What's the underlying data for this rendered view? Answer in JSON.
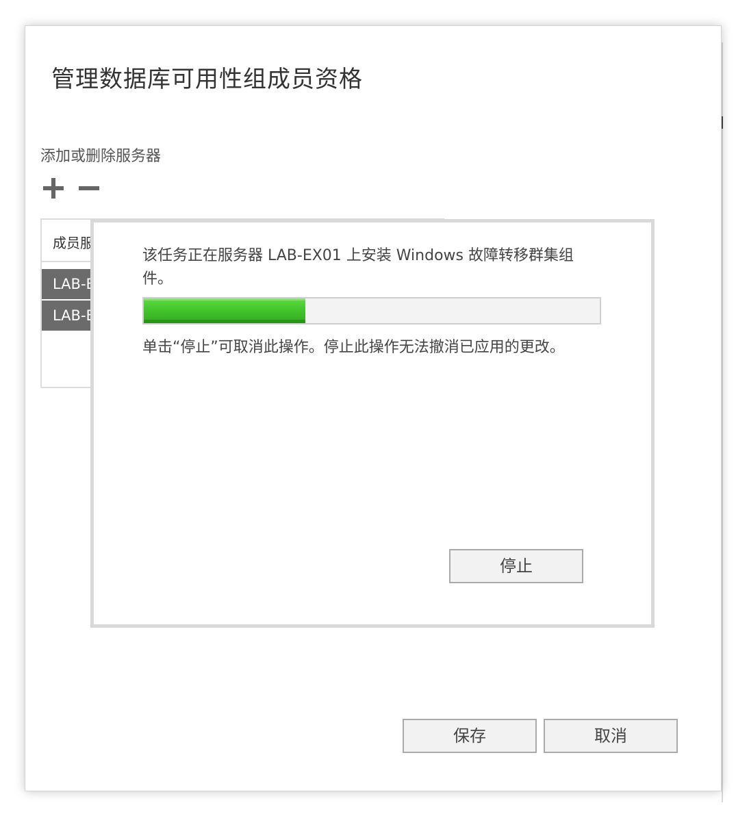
{
  "dialog": {
    "title": "管理数据库可用性组成员资格",
    "section_label": "添加或删除服务器",
    "members": {
      "header": "成员服",
      "rows": [
        "LAB-E",
        "LAB-E"
      ]
    },
    "buttons": {
      "save": "保存",
      "cancel": "取消"
    },
    "icons": {
      "add": "plus-icon",
      "remove": "minus-icon"
    }
  },
  "progress": {
    "message": "该任务正在服务器 LAB-EX01 上安装 Windows 故障转移群集组件。",
    "percent": 35.5,
    "hint": "单击“停止”可取消此操作。停止此操作无法撤消已应用的更改。",
    "stop_label": "停止",
    "bar_color": "#44c72b"
  }
}
